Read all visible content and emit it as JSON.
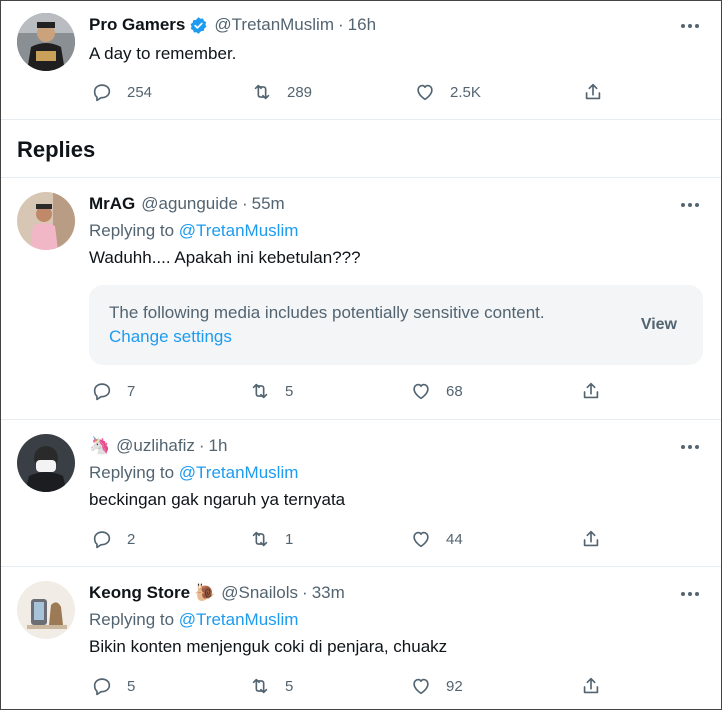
{
  "main_tweet": {
    "name": "Pro Gamers",
    "handle": "@TretanMuslim",
    "time": "16h",
    "text": "A day to remember.",
    "replies": "254",
    "retweets": "289",
    "likes": "2.5K"
  },
  "replies_heading": "Replies",
  "replies": [
    {
      "name": "MrAG",
      "handle": "@agunguide",
      "time": "55m",
      "replying_prefix": "Replying to",
      "replying_to": "@TretanMuslim",
      "text": "Waduhh.... Apakah ini kebetulan???",
      "sensitive": {
        "message": "The following media includes potentially sensitive content.",
        "change_link": "Change settings",
        "view_label": "View"
      },
      "reply_count": "7",
      "retweet_count": "5",
      "like_count": "68"
    },
    {
      "name_emoji": "🦄",
      "handle": "@uzlihafiz",
      "time": "1h",
      "replying_prefix": "Replying to",
      "replying_to": "@TretanMuslim",
      "text": "beckingan gak ngaruh ya ternyata",
      "reply_count": "2",
      "retweet_count": "1",
      "like_count": "44"
    },
    {
      "name": "Keong Store",
      "name_emoji": "🐌",
      "handle": "@Snailols",
      "time": "33m",
      "replying_prefix": "Replying to",
      "replying_to": "@TretanMuslim",
      "text": "Bikin konten menjenguk coki di penjara, chuakz",
      "reply_count": "5",
      "retweet_count": "5",
      "like_count": "92"
    }
  ],
  "colors": {
    "accent": "#1d9bf0",
    "secondary_text": "#536471",
    "divider": "#e6ecf0"
  },
  "icons": [
    "verified-badge-icon",
    "more-icon",
    "reply-icon",
    "retweet-icon",
    "like-icon",
    "share-icon"
  ]
}
